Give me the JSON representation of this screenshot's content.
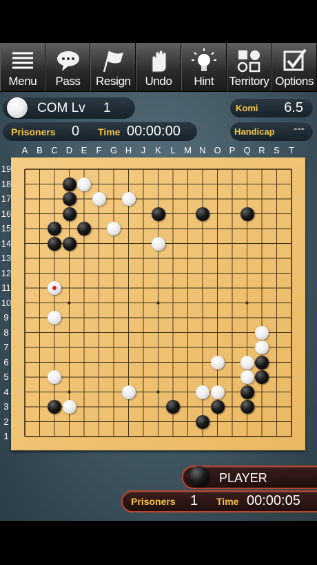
{
  "toolbar": {
    "buttons": [
      {
        "label": "Menu",
        "icon": "menu-icon"
      },
      {
        "label": "Pass",
        "icon": "speech-bubble-icon"
      },
      {
        "label": "Resign",
        "icon": "flag-icon"
      },
      {
        "label": "Undo",
        "icon": "hand-icon"
      },
      {
        "label": "Hint",
        "icon": "lightbulb-icon"
      },
      {
        "label": "Territory",
        "icon": "territory-icon"
      },
      {
        "label": "Options",
        "icon": "checkbox-icon"
      }
    ]
  },
  "com": {
    "label": "COM Lv",
    "level": "1",
    "prisoners_label": "Prisoners",
    "prisoners": "0",
    "time_label": "Time",
    "time": "00:00:00",
    "stone_color": "white"
  },
  "game": {
    "komi_label": "Komi",
    "komi": "6.5",
    "handicap_label": "Handicap",
    "handicap": "---"
  },
  "player": {
    "label": "PLAYER",
    "prisoners_label": "Prisoners",
    "prisoners": "1",
    "time_label": "Time",
    "time": "00:00:05",
    "stone_color": "black"
  },
  "board": {
    "size": 19,
    "columns": [
      "A",
      "B",
      "C",
      "D",
      "E",
      "F",
      "G",
      "H",
      "J",
      "K",
      "L",
      "M",
      "N",
      "O",
      "P",
      "Q",
      "R",
      "S",
      "T"
    ],
    "rows": [
      "19",
      "18",
      "17",
      "16",
      "15",
      "14",
      "13",
      "12",
      "11",
      "10",
      "9",
      "8",
      "7",
      "6",
      "5",
      "4",
      "3",
      "2",
      "1"
    ],
    "star_points": [
      "D16",
      "K16",
      "Q16",
      "D10",
      "K10",
      "Q10",
      "D4",
      "K4",
      "Q4"
    ],
    "black_stones": [
      "D18",
      "D17",
      "D16",
      "K16",
      "N16",
      "Q16",
      "C15",
      "E15",
      "C14",
      "D14",
      "C3",
      "L3",
      "N2",
      "O3",
      "Q3",
      "Q4",
      "R5",
      "R6"
    ],
    "white_stones": [
      "E18",
      "F17",
      "H17",
      "G15",
      "K14",
      "C11",
      "C9",
      "R8",
      "R7",
      "O6",
      "Q6",
      "C5",
      "Q5",
      "H4",
      "N4",
      "O4",
      "D3"
    ],
    "last_move": "C11",
    "colors": {
      "board": "#f0c272",
      "line": "#3a2a10",
      "accent": "#f4c540",
      "player_border": "#b9452f"
    }
  }
}
